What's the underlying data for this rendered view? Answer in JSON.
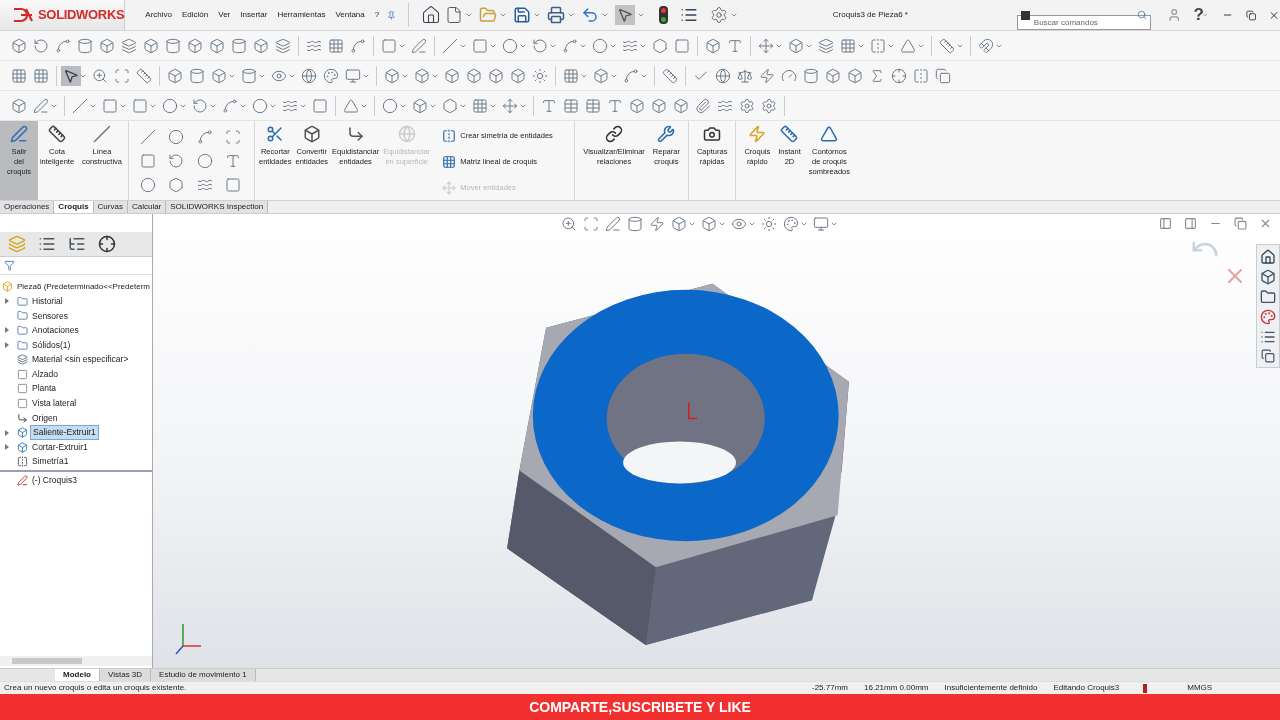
{
  "title_bar": {
    "logo": "SOLIDWORKS",
    "menu": [
      "Archivo",
      "Edición",
      "Ver",
      "Insertar",
      "Herramientas",
      "Ventana",
      "?"
    ],
    "title": "Croquis3 de Pieza6 *",
    "search": {
      "placeholder": "Buscar comandos"
    },
    "help": "?"
  },
  "command_manager": {
    "large": [
      {
        "label": "Salir\ndel\ncroquis",
        "selected": true
      },
      {
        "label": "Cota\ninteligente",
        "selected": false
      },
      {
        "label": "Línea\nconstructiva",
        "selected": false
      }
    ],
    "edit": [
      {
        "label": "Recortar\nentidades",
        "disabled": false
      },
      {
        "label": "Convertir\nentidades",
        "disabled": false
      },
      {
        "label": "Equidistanciar\nentidades",
        "disabled": false
      },
      {
        "label": "Equidistanciar\nen superficie",
        "disabled": true
      }
    ],
    "small": [
      {
        "label": "Crear simetría de entidades",
        "disabled": false
      },
      {
        "label": "Matriz lineal de croquis",
        "disabled": false
      },
      {
        "label": "Mover entidades",
        "disabled": true
      }
    ],
    "tools": [
      {
        "label": "Visualizar/Eliminar\nrelaciones"
      },
      {
        "label": "Reparar\ncroquis"
      },
      {
        "label": "Capturas\nrápidas"
      },
      {
        "label": "Croquis\nrápido"
      },
      {
        "label": "Instant\n2D"
      },
      {
        "label": "Contornos\nde croquis\nsombreados"
      }
    ]
  },
  "tabs": [
    {
      "label": "Operaciones",
      "selected": false
    },
    {
      "label": "Croquis",
      "selected": true
    },
    {
      "label": "Curvas",
      "selected": false
    },
    {
      "label": "Calcular",
      "selected": false
    },
    {
      "label": "SOLIDWORKS Inspection",
      "selected": false
    }
  ],
  "feature_tree": {
    "root": "Pieza6  (Predeterminado<<Predeterm",
    "items": [
      {
        "label": "Historial",
        "kind": "folder",
        "expandable": true,
        "selected": false
      },
      {
        "label": "Sensores",
        "kind": "folder",
        "expandable": false,
        "selected": false
      },
      {
        "label": "Anotaciones",
        "kind": "folder",
        "expandable": true,
        "selected": false
      },
      {
        "label": "Sólidos(1)",
        "kind": "folder",
        "expandable": true,
        "selected": false
      },
      {
        "label": "Material <sin especificar>",
        "kind": "material",
        "expandable": false,
        "selected": false
      },
      {
        "label": "Alzado",
        "kind": "plane",
        "expandable": false,
        "selected": false
      },
      {
        "label": "Planta",
        "kind": "plane",
        "expandable": false,
        "selected": false
      },
      {
        "label": "Vista lateral",
        "kind": "plane",
        "expandable": false,
        "selected": false
      },
      {
        "label": "Origen",
        "kind": "origin",
        "expandable": false,
        "selected": false
      },
      {
        "label": "Saliente-Extruir1",
        "kind": "feature",
        "expandable": true,
        "selected": true
      },
      {
        "label": "Cortar-Extruir1",
        "kind": "feature",
        "expandable": true,
        "selected": false
      },
      {
        "label": "Simetría1",
        "kind": "mirror",
        "expandable": false,
        "selected": false
      }
    ],
    "after_rollback": [
      {
        "label": "(-) Croquis3",
        "kind": "sketch",
        "expandable": false,
        "selected": false
      }
    ]
  },
  "bottom_tabs": [
    {
      "label": "Modelo",
      "selected": true
    },
    {
      "label": "Vistas 3D",
      "selected": false
    },
    {
      "label": "Estudio de movimiento 1",
      "selected": false
    }
  ],
  "status_bar": {
    "message": "Crea un nuevo croquis o edita un croquis existente.",
    "fields": [
      "-25.77mm",
      "16.21mm 0.00mm",
      "Insuficientemente definido",
      "Editando Croquis3"
    ],
    "units": "MMGS"
  },
  "banner": "COMPARTE,SUSCRIBETE Y LIKE"
}
